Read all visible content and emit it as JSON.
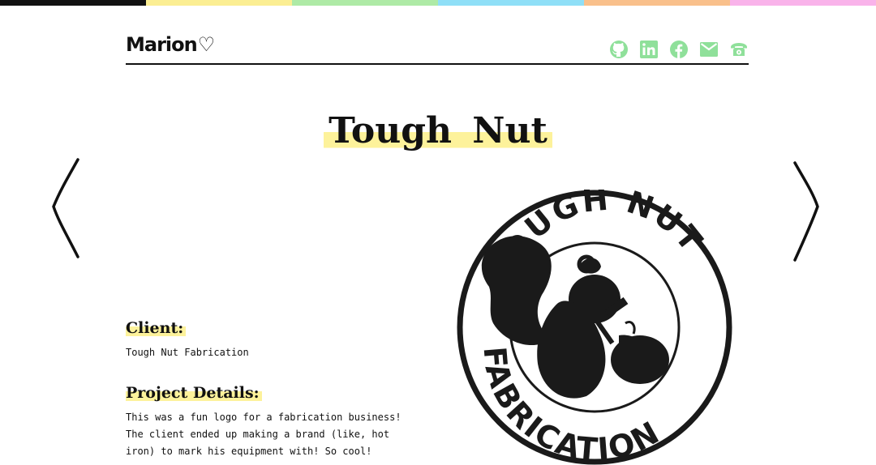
{
  "brand": {
    "name": "Marion",
    "heart": "♡"
  },
  "accent_colors": [
    "#111111",
    "#fbee93",
    "#aeeaa6",
    "#8fdff7",
    "#f9c08b",
    "#f9b3ea"
  ],
  "highlight_color": "#fdf29b",
  "social_color": "#8fe09a",
  "socials": [
    {
      "icon": "github-icon"
    },
    {
      "icon": "linkedin-icon"
    },
    {
      "icon": "facebook-icon"
    },
    {
      "icon": "email-icon"
    },
    {
      "icon": "phone-icon"
    }
  ],
  "project": {
    "title": "Tough Nut",
    "client_label": "Client:",
    "client_value": "Tough Nut Fabrication",
    "details_label": "Project Details:",
    "details_text": "This was a fun logo for a fabrication business!\nThe client ended up making a brand (like, hot\niron) to mark his equipment with!  So cool!"
  },
  "logo_image": {
    "top_text": "TOUGH NUT",
    "bottom_text": "FABRICATION"
  }
}
